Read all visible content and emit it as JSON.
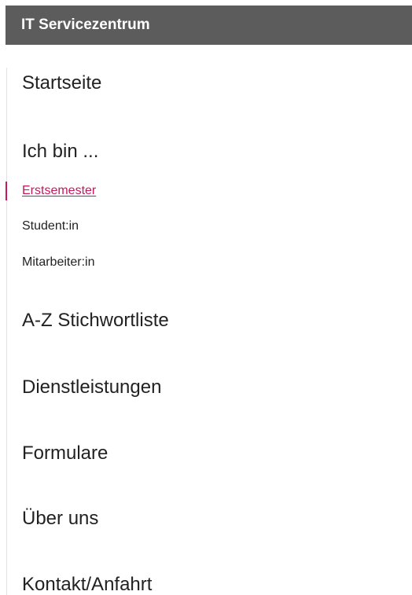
{
  "header": {
    "title": "IT Servicezentrum"
  },
  "nav": {
    "startseite": "Startseite",
    "ich_bin": "Ich bin ...",
    "sub_items": [
      "Erstsemester",
      "Student:in",
      "Mitarbeiter:in"
    ],
    "active_sub_item": "Erstsemester",
    "items": [
      "A-Z Stichwortliste",
      "Dienstleistungen",
      "Formulare",
      "Über uns",
      "Kontakt/Anfahrt"
    ]
  },
  "colors": {
    "header_bg": "#5c5c5c",
    "accent": "#c5185d",
    "text": "#222222"
  }
}
